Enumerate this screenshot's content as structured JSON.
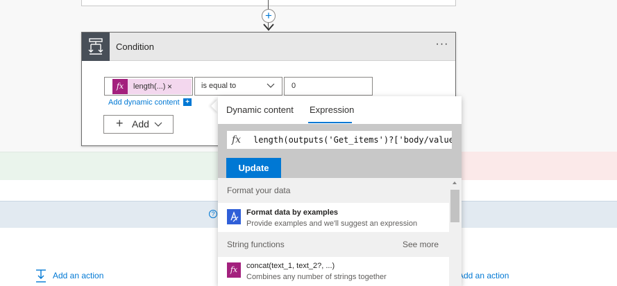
{
  "condition": {
    "title": "Condition",
    "more_label": "···",
    "token_label": "length(...)",
    "token_remove": "×",
    "operator": "is equal to",
    "value": "0",
    "add_dynamic_label": "Add dynamic content",
    "add_label": "Add"
  },
  "bottom": {
    "add_action_left": "Add an action",
    "add_action_right": "Add an action",
    "help_glyph": "?"
  },
  "connector": {
    "plus": "+"
  },
  "popup": {
    "tabs": [
      {
        "label": "Dynamic content",
        "active": false
      },
      {
        "label": "Expression",
        "active": true
      }
    ],
    "fx_symbol": "fx",
    "expression_value": "length(outputs('Get_items')?['body/value'])",
    "update_label": "Update",
    "sections": [
      {
        "title": "Format your data",
        "items": [
          {
            "title": "Format data by examples",
            "description": "Provide examples and we'll suggest an expression",
            "icon": "format-data-icon",
            "icon_color": "#2f5fd8"
          }
        ]
      },
      {
        "title": "String functions",
        "see_more": "See more",
        "items": [
          {
            "title": "concat(text_1, text_2?, ...)",
            "description": "Combines any number of strings together",
            "icon": "fx-function-icon",
            "icon_color": "#a3207d"
          }
        ]
      }
    ]
  },
  "colors": {
    "accent": "#0078d4",
    "token_bg": "#f3d7ee",
    "function_icon": "#a3207d",
    "condition_icon_bg": "#484f58"
  }
}
